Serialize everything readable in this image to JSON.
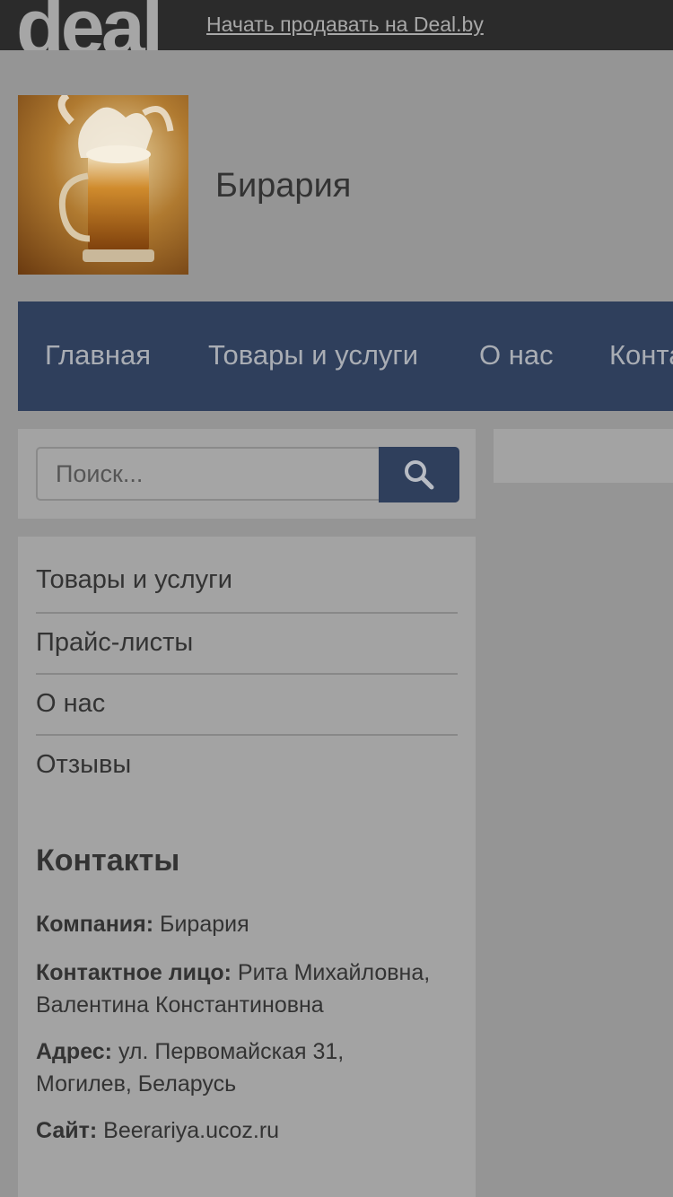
{
  "topbar": {
    "logo_text": "deal",
    "sell_link": "Начать продавать на Deal.by"
  },
  "company": {
    "name": "Бирария",
    "logo_icon": "beer-mug-image"
  },
  "nav": {
    "items": [
      {
        "label": "Главная"
      },
      {
        "label": "Товары и услуги"
      },
      {
        "label": "О нас"
      },
      {
        "label": "Конта"
      }
    ]
  },
  "search": {
    "placeholder": "Поиск...",
    "button_icon": "search-icon"
  },
  "sidebar": {
    "menu": [
      {
        "label": "Товары и услуги"
      },
      {
        "label": "Прайс-листы"
      },
      {
        "label": "О нас"
      },
      {
        "label": "Отзывы"
      }
    ]
  },
  "contacts": {
    "title": "Контакты",
    "company_label": "Компания:",
    "company_value": "Бирария",
    "person_label": "Контактное лицо:",
    "person_value_1": "Рита Михайловна,",
    "person_value_2": "Валентина Константиновна",
    "address_label": "Адрес:",
    "address_value_1": "ул. Первомайская 31,",
    "address_value_2": "Могилев, Беларусь",
    "site_label": "Сайт:",
    "site_value": "Beerariya.ucoz.ru"
  },
  "colors": {
    "nav_bg": "#2f3f5c",
    "topbar_bg": "#2b2b2b",
    "page_bg": "#959595"
  }
}
